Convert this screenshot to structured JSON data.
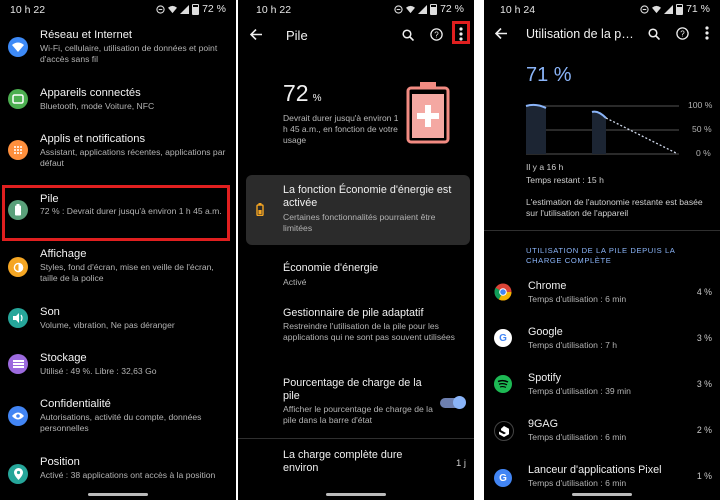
{
  "panel1": {
    "status": {
      "time": "10 h 22",
      "battery": "72 %"
    },
    "items": [
      {
        "title": "Réseau et Internet",
        "subtitle": "Wi-Fi, cellulaire, utilisation de données et point d'accès sans fil",
        "color": "#3d8af7"
      },
      {
        "title": "Appareils connectés",
        "subtitle": "Bluetooth, mode Voiture, NFC",
        "color": "#4caf50"
      },
      {
        "title": "Applis et notifications",
        "subtitle": "Assistant, applications récentes, applications par défaut",
        "color": "#ff8f3c"
      },
      {
        "title": "Pile",
        "subtitle": "72 % : Devrait durer jusqu'à environ 1 h 45 a.m.",
        "color": "#5aa07a"
      },
      {
        "title": "Affichage",
        "subtitle": "Styles, fond d'écran, mise en veille de l'écran, taille de la police",
        "color": "#f5a623"
      },
      {
        "title": "Son",
        "subtitle": "Volume, vibration, Ne pas déranger",
        "color": "#26a69a"
      },
      {
        "title": "Stockage",
        "subtitle": "Utilisé : 49 %. Libre : 32,63 Go",
        "color": "#9c6ade"
      },
      {
        "title": "Confidentialité",
        "subtitle": "Autorisations, activité du compte, données personnelles",
        "color": "#4285f4"
      },
      {
        "title": "Position",
        "subtitle": "Activé : 38 applications ont accès à la position",
        "color": "#26a69a"
      }
    ]
  },
  "panel2": {
    "status": {
      "time": "10 h 22",
      "battery": "72 %"
    },
    "title": "Pile",
    "percent": "72",
    "percent_unit": "%",
    "estimate": "Devrait durer jusqu'à environ 1 h 45 a.m., en fonction de votre usage",
    "saver_card": {
      "title": "La fonction Économie d'énergie est activée",
      "subtitle": "Certaines fonctionnalités pourraient être limitées"
    },
    "items": [
      {
        "title": "Économie d'énergie",
        "subtitle": "Activé"
      },
      {
        "title": "Gestionnaire de pile adaptatif",
        "subtitle": "Restreindre l'utilisation de la pile pour les applications qui ne sont pas souvent utilisées"
      },
      {
        "title": "Pourcentage de charge de la pile",
        "subtitle": "Afficher le pourcentage de charge de la pile dans la barre d'état"
      },
      {
        "title": "La charge complète dure environ",
        "value": "1 j"
      }
    ]
  },
  "panel3": {
    "status": {
      "time": "10 h 24",
      "battery": "71 %"
    },
    "title": "Utilisation de la p…",
    "percent": "71 %",
    "chart_labels": [
      "100 %",
      "50 %",
      "0 %"
    ],
    "since": "Il y a 16 h",
    "remaining": "Temps restant : 15 h",
    "estimate_note": "L'estimation de l'autonomie restante est basée sur l'utilisation de l'appareil",
    "section_header": "UTILISATION DE LA PILE DEPUIS LA CHARGE COMPLÈTE",
    "apps": [
      {
        "name": "Chrome",
        "usage": "Temps d'utilisation : 6 min",
        "pct": "4 %"
      },
      {
        "name": "Google",
        "usage": "Temps d'utilisation : 7 h",
        "pct": "3 %"
      },
      {
        "name": "Spotify",
        "usage": "Temps d'utilisation : 39 min",
        "pct": "3 %"
      },
      {
        "name": "9GAG",
        "usage": "Temps d'utilisation : 6 min",
        "pct": "2 %"
      },
      {
        "name": "Lanceur d'applications Pixel",
        "usage": "Temps d'utilisation : 6 min",
        "pct": "1 %"
      }
    ]
  },
  "colors": {
    "accent_blue": "#8ab4f8",
    "highlight_red": "#e01f1f",
    "battery_pink": "#f28b82"
  }
}
